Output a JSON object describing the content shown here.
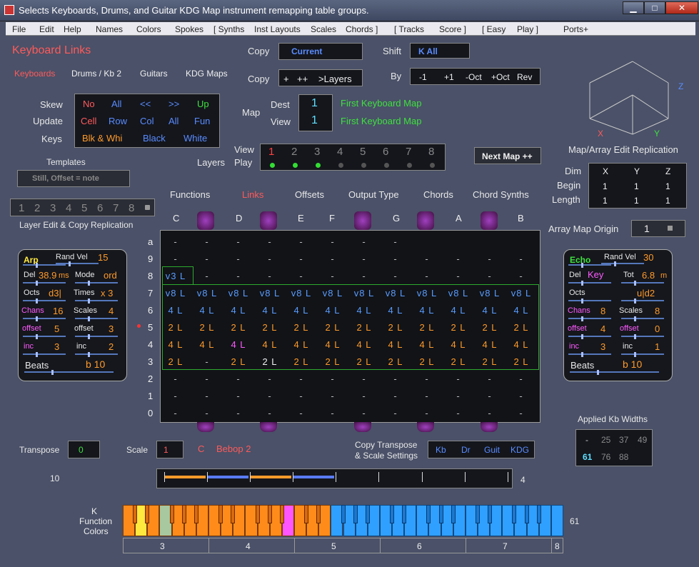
{
  "window": {
    "title": "Selects Keyboards, Drums, and Guitar KDG Map instrument remapping table groups.",
    "min": "▁",
    "max": "□",
    "close": "✕"
  },
  "menu": [
    "File",
    "Edit",
    "Help",
    "Names",
    "Colors",
    "Spokes",
    "[  Synths",
    "Inst Layouts",
    "Scales",
    "Chords  ]",
    "[  Tracks",
    "Score  ]",
    "[  Easy",
    "Play  ]",
    "Ports+"
  ],
  "header": {
    "title": "Keyboard  Links",
    "tabs": [
      "Keyboards",
      "Drums / Kb 2",
      "Guitars",
      "KDG Maps"
    ]
  },
  "copy": {
    "label1": "Copy",
    "value1": "Current",
    "label2": "Copy",
    "plus": "+",
    "plusplus": "++",
    "layers": ">Layers"
  },
  "shift": {
    "label": "Shift",
    "value": "K  All",
    "by_label": "By",
    "by_items": [
      "-1",
      "+1",
      "-Oct",
      "+Oct",
      "Rev"
    ]
  },
  "skew": {
    "labels": [
      "Skew",
      "Update",
      "Keys"
    ],
    "row1": [
      "No",
      "All",
      "<<",
      ">>",
      "Up"
    ],
    "row2": [
      "Cell",
      "Row",
      "Col",
      "All",
      "Fun"
    ],
    "row3": [
      "Blk & Whi",
      "Black",
      "White"
    ]
  },
  "map": {
    "label": "Map",
    "dest_label": "Dest",
    "view_label": "View",
    "dest_value": "1",
    "view_value": "1",
    "dest_name": "First Keyboard Map",
    "view_name": "First Keyboard Map"
  },
  "templates": {
    "label": "Templates",
    "value": "Still, Offset = note"
  },
  "layers": {
    "label": "Layers",
    "view_label": "View",
    "play_label": "Play",
    "numbers": [
      "1",
      "2",
      "3",
      "4",
      "5",
      "6",
      "7",
      "8"
    ]
  },
  "next_map": "Next Map ++",
  "layer_edit": {
    "numbers": [
      "1",
      "2",
      "3",
      "4",
      "5",
      "6",
      "7",
      "8"
    ],
    "label": "Layer Edit & Copy Replication"
  },
  "functions": [
    "Functions",
    "Links",
    "Offsets",
    "Output Type",
    "Chords",
    "Chord Synths"
  ],
  "notes": [
    "C",
    "D",
    "E",
    "F",
    "G",
    "A",
    "B"
  ],
  "rows": [
    "a",
    "9",
    "8",
    "7",
    "6",
    "5",
    "4",
    "3",
    "2",
    "1",
    "0"
  ],
  "grid": {
    "a": [
      "-",
      "-",
      "-",
      "-",
      "-",
      "-",
      "-",
      "-"
    ],
    "9": [
      "-",
      "-",
      "-",
      "-",
      "-",
      "-",
      "-",
      "-",
      "-",
      "-",
      "-",
      "-"
    ],
    "8": [
      "v3L",
      "-",
      "-",
      "-",
      "-",
      "-",
      "-",
      "-",
      "-",
      "-",
      "-",
      "-"
    ],
    "7": [
      "v8L",
      "v8L",
      "v8L",
      "v8L",
      "v8L",
      "v8L",
      "v8L",
      "v8L",
      "v8L",
      "v8L",
      "v8L",
      "v8L"
    ],
    "6": [
      "4L",
      "4L",
      "4L",
      "4L",
      "4L",
      "4L",
      "4L",
      "4L",
      "4L",
      "4L",
      "4L",
      "4L"
    ],
    "5": [
      "2L",
      "2L",
      "2L",
      "2L",
      "2L",
      "2L",
      "2L",
      "2L",
      "2L",
      "2L",
      "2L",
      "2L"
    ],
    "4": [
      "4L",
      "4L",
      "4L",
      "4L",
      "4L",
      "4L",
      "4L",
      "4L",
      "4L",
      "4L",
      "4L",
      "4L"
    ],
    "3": [
      "2L",
      "-",
      "2L",
      "2L",
      "2L",
      "2L",
      "2L",
      "2L",
      "2L",
      "2L",
      "2L",
      "2L"
    ],
    "2": [
      "-",
      "-",
      "-",
      "-",
      "-",
      "-",
      "-",
      "-",
      "-",
      "-",
      "-",
      "-"
    ],
    "1": [
      "-",
      "-",
      "-",
      "-",
      "-",
      "-",
      "-",
      "-",
      "-",
      "-",
      "-",
      "-"
    ],
    "0": [
      "-",
      "-",
      "-",
      "-",
      "-",
      "-",
      "-",
      "-",
      "-",
      "-",
      "-",
      "-"
    ]
  },
  "replication": {
    "title": "Map/Array Edit Replication",
    "axes": [
      "X",
      "Y",
      "Z"
    ],
    "dim_label": "Dim",
    "begin_label": "Begin",
    "length_label": "Length",
    "begin": [
      "1",
      "1",
      "1"
    ],
    "length": [
      "1",
      "1",
      "1"
    ]
  },
  "array_origin": {
    "label": "Array Map Origin",
    "value": "1"
  },
  "arp": {
    "title": "Arp",
    "rand_vel_label": "Rand Vel",
    "rand_vel": "15",
    "del_label": "Del",
    "del": "38.9",
    "del_unit": "ms",
    "mode_label": "Mode",
    "mode": "ord",
    "octs_label": "Octs",
    "octs": "d3|",
    "times_label": "Times",
    "times": "x 3",
    "chans_label": "Chans",
    "chans": "16",
    "scales_label": "Scales",
    "scales": "4",
    "offset_label": "offset",
    "offset1": "5",
    "offset2": "3",
    "inc_label": "inc",
    "inc1": "3",
    "inc2": "2",
    "beats_label": "Beats",
    "beats": "b 10"
  },
  "echo": {
    "title": "Echo",
    "rand_vel_label": "Rand Vel",
    "rand_vel": "30",
    "del_label": "Del",
    "key": "Key",
    "tot_label": "Tot",
    "tot": "6.8",
    "tot_unit": "m",
    "octs_label": "Octs",
    "octs": "u|d2",
    "chans_label": "Chans",
    "chans": "8",
    "scales_label": "Scales",
    "scales": "8",
    "offset_label": "offset",
    "offset1": "4",
    "offset2": "0",
    "inc_label": "inc",
    "inc1": "3",
    "inc2": "1",
    "beats_label": "Beats",
    "beats": "b 10"
  },
  "applied": {
    "label": "Applied Kb Widths",
    "row1": [
      "-",
      "25",
      "37",
      "49"
    ],
    "row2": [
      "61",
      "76",
      "88"
    ]
  },
  "transpose": {
    "label": "Transpose",
    "value": "0",
    "scale_label": "Scale",
    "scale_value": "1",
    "scale_note": "C",
    "scale_name": "Bebop  2",
    "copy_label1": "Copy Transpose",
    "copy_label2": "& Scale Settings",
    "kdg": [
      "Kb",
      "Dr",
      "Guit",
      "KDG"
    ]
  },
  "range": {
    "left": "10",
    "right": "4"
  },
  "keyboard": {
    "label": "K\nFunction\nColors",
    "label1": "K",
    "label2": "Function",
    "label3": "Colors",
    "right": "61",
    "octaves": [
      "3",
      "4",
      "5",
      "6",
      "7",
      "8"
    ]
  }
}
